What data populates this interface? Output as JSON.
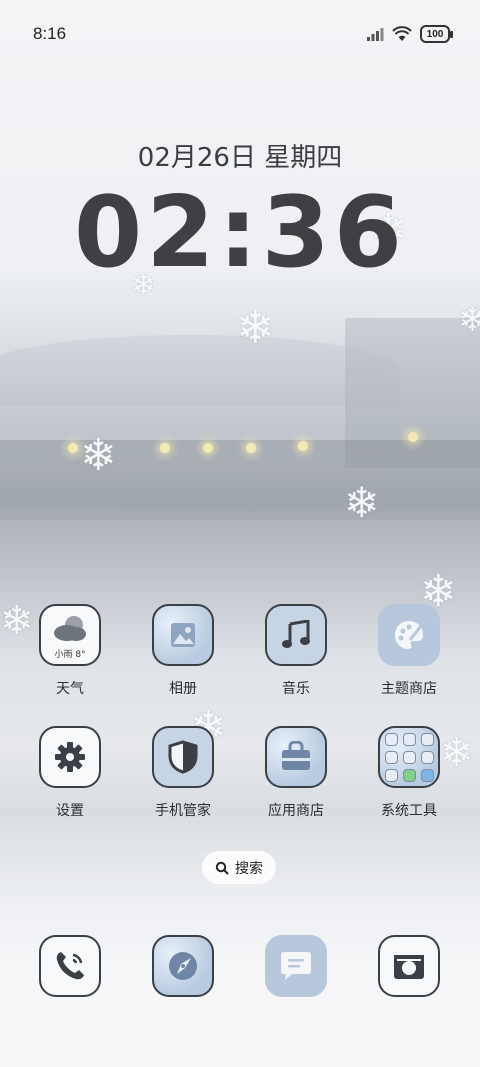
{
  "status_bar": {
    "time": "8:16",
    "battery": "100",
    "icons": [
      "signal-icon",
      "wifi-icon",
      "battery-icon"
    ]
  },
  "lock": {
    "date": "02月26日 星期四",
    "time": "02:36"
  },
  "apps_row1": [
    {
      "label": "天气",
      "icon": "weather-icon",
      "weather_text": "小雨 8°"
    },
    {
      "label": "相册",
      "icon": "gallery-icon"
    },
    {
      "label": "音乐",
      "icon": "music-icon"
    },
    {
      "label": "主题商店",
      "icon": "palette-icon"
    }
  ],
  "apps_row2": [
    {
      "label": "设置",
      "icon": "gear-icon"
    },
    {
      "label": "手机管家",
      "icon": "shield-icon"
    },
    {
      "label": "应用商店",
      "icon": "shopping-bag-icon"
    },
    {
      "label": "系统工具",
      "icon": "folder-icon"
    }
  ],
  "search": {
    "label": "搜索",
    "icon": "search-icon"
  },
  "dock": [
    {
      "name": "phone",
      "icon": "phone-icon"
    },
    {
      "name": "browser",
      "icon": "compass-icon"
    },
    {
      "name": "messages",
      "icon": "message-icon"
    },
    {
      "name": "camera",
      "icon": "camera-icon"
    }
  ],
  "colors": {
    "icon_outline": "#3b3f46",
    "icon_blue": "#b7c7dc",
    "text_dark": "#3e4046"
  }
}
